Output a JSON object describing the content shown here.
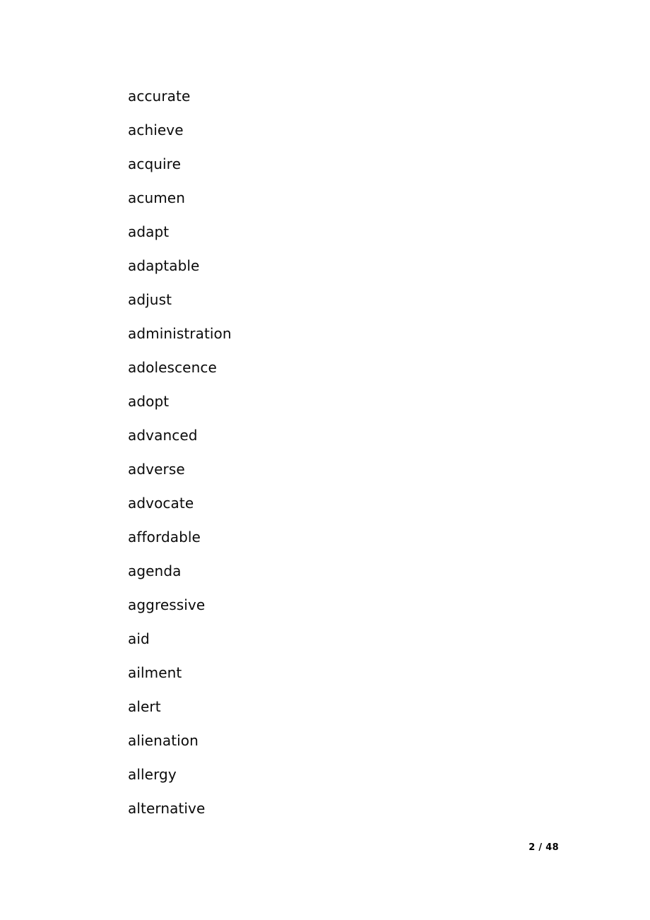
{
  "document": {
    "type": "vocabulary-word-list",
    "words": [
      "accurate",
      "achieve",
      "acquire",
      "acumen",
      "adapt",
      "adaptable",
      "adjust",
      "administration",
      "adolescence",
      "adopt",
      "advanced",
      "adverse",
      "advocate",
      "affordable",
      "agenda",
      "aggressive",
      "aid",
      "ailment",
      "alert",
      "alienation",
      "allergy",
      "alternative"
    ],
    "footer": {
      "page_label": "2 / 48",
      "current_page": "2",
      "total_pages": "48"
    },
    "colors": {
      "text": "#0a0a0a",
      "background": "#ffffff"
    }
  }
}
